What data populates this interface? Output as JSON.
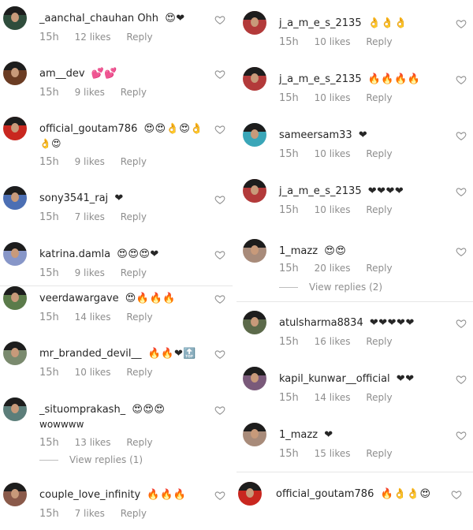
{
  "colors": {
    "heart_outline": "#8e8e8e",
    "meta_text": "#8e8e8e",
    "username": "#262626"
  },
  "left_column": [
    {
      "username": "_aanchal_chauhan",
      "text": "Ohh",
      "emojis": "😍❤",
      "time": "15h",
      "likes": "12 likes",
      "reply": "Reply",
      "avatar_bg": "#2f4d3c"
    },
    {
      "username": "am__dev",
      "text": "",
      "emojis": "💕💕",
      "time": "15h",
      "likes": "9 likes",
      "reply": "Reply",
      "avatar_bg": "#6b3c23"
    },
    {
      "username": "official_goutam786",
      "text": "",
      "emojis": "😍😍👌😍👌",
      "emojis2": "👌😍",
      "time": "15h",
      "likes": "9 likes",
      "reply": "Reply",
      "avatar_bg": "#c9271f"
    },
    {
      "username": "sony3541_raj",
      "text": "",
      "emojis": "❤",
      "time": "15h",
      "likes": "7 likes",
      "reply": "Reply",
      "avatar_bg": "#4c6fb4"
    },
    {
      "username": "katrina.damla",
      "text": "",
      "emojis": "😍😍😍❤",
      "time": "15h",
      "likes": "9 likes",
      "reply": "Reply",
      "avatar_bg": "#8796c8"
    },
    {
      "username": "veerdawargave",
      "text": "",
      "emojis": "😍🔥🔥🔥",
      "time": "15h",
      "likes": "14 likes",
      "reply": "Reply",
      "avatar_bg": "#5b7b4a"
    },
    {
      "username": "mr_branded_devil__",
      "text": "",
      "emojis": "🔥🔥❤🔝",
      "time": "15h",
      "likes": "10 likes",
      "reply": "Reply",
      "avatar_bg": "#7a8a6e"
    },
    {
      "username": "_situomprakash_",
      "text": "wowwww",
      "emojis": "😍😍😍",
      "time": "15h",
      "likes": "13 likes",
      "reply": "Reply",
      "view_replies": "View replies (1)",
      "avatar_bg": "#5c7e7a"
    },
    {
      "username": "couple_love_infinity",
      "text": "",
      "emojis": "🔥🔥🔥",
      "time": "15h",
      "likes": "7 likes",
      "reply": "Reply",
      "avatar_bg": "#8a5a4a"
    }
  ],
  "right_column": [
    {
      "username": "j_a_m_e_s_2135",
      "text": "",
      "emojis": "👌👌👌",
      "time": "15h",
      "likes": "10 likes",
      "reply": "Reply",
      "avatar_bg": "#b33a3a"
    },
    {
      "username": "j_a_m_e_s_2135",
      "text": "",
      "emojis": "🔥🔥🔥🔥",
      "time": "15h",
      "likes": "10 likes",
      "reply": "Reply",
      "avatar_bg": "#b33a3a"
    },
    {
      "username": "sameersam33",
      "text": "",
      "emojis": "❤",
      "time": "15h",
      "likes": "10 likes",
      "reply": "Reply",
      "avatar_bg": "#3aa6b8"
    },
    {
      "username": "j_a_m_e_s_2135",
      "text": "",
      "emojis": "❤❤❤❤",
      "time": "15h",
      "likes": "10 likes",
      "reply": "Reply",
      "avatar_bg": "#b33a3a"
    },
    {
      "username": "1_mazz",
      "text": "",
      "emojis": "😍😍",
      "time": "15h",
      "likes": "20 likes",
      "reply": "Reply",
      "view_replies": "View replies (2)",
      "avatar_bg": "#a88b7a"
    },
    {
      "username": "atulsharma8834",
      "text": "",
      "emojis": "❤❤❤❤❤",
      "time": "15h",
      "likes": "16 likes",
      "reply": "Reply",
      "avatar_bg": "#5c6a4a"
    },
    {
      "username": "kapil_kunwar__official",
      "text": "",
      "emojis": "❤❤",
      "time": "15h",
      "likes": "14 likes",
      "reply": "Reply",
      "avatar_bg": "#7a5a7a"
    },
    {
      "username": "1_mazz",
      "text": "",
      "emojis": "❤",
      "time": "15h",
      "likes": "15 likes",
      "reply": "Reply",
      "avatar_bg": "#a88b7a"
    },
    {
      "username": "official_goutam786",
      "text": "",
      "emojis": "🔥👌👌😍",
      "time": "15h",
      "likes": "",
      "reply": "",
      "avatar_bg": "#c9271f"
    }
  ]
}
